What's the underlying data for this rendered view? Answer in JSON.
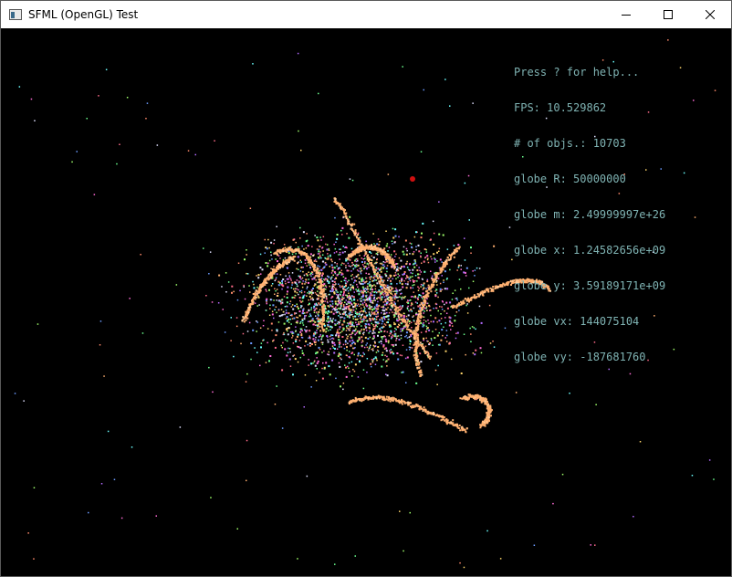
{
  "window": {
    "title": "SFML (OpenGL) Test",
    "icon": "app-window-icon",
    "controls": [
      "minimize-icon",
      "maximize-icon",
      "close-icon"
    ]
  },
  "hud": {
    "help": "Press ? for help...",
    "fps": "FPS: 10.529862",
    "objects": "# of objs.: 10703",
    "globe_r": "globe R: 50000000",
    "globe_m": "globe m: 2.49999997e+26",
    "globe_x": "globe x: 1.24582656e+09",
    "globe_y": "globe y: 3.59189171e+09",
    "globe_vx": "globe vx: 144075104",
    "globe_vy": "globe vy: -187681760"
  },
  "colors": {
    "background": "#000000",
    "hud_text": "#7fb3b3",
    "particle_orange": "#ffb070",
    "globe_marker": "#d01010"
  }
}
